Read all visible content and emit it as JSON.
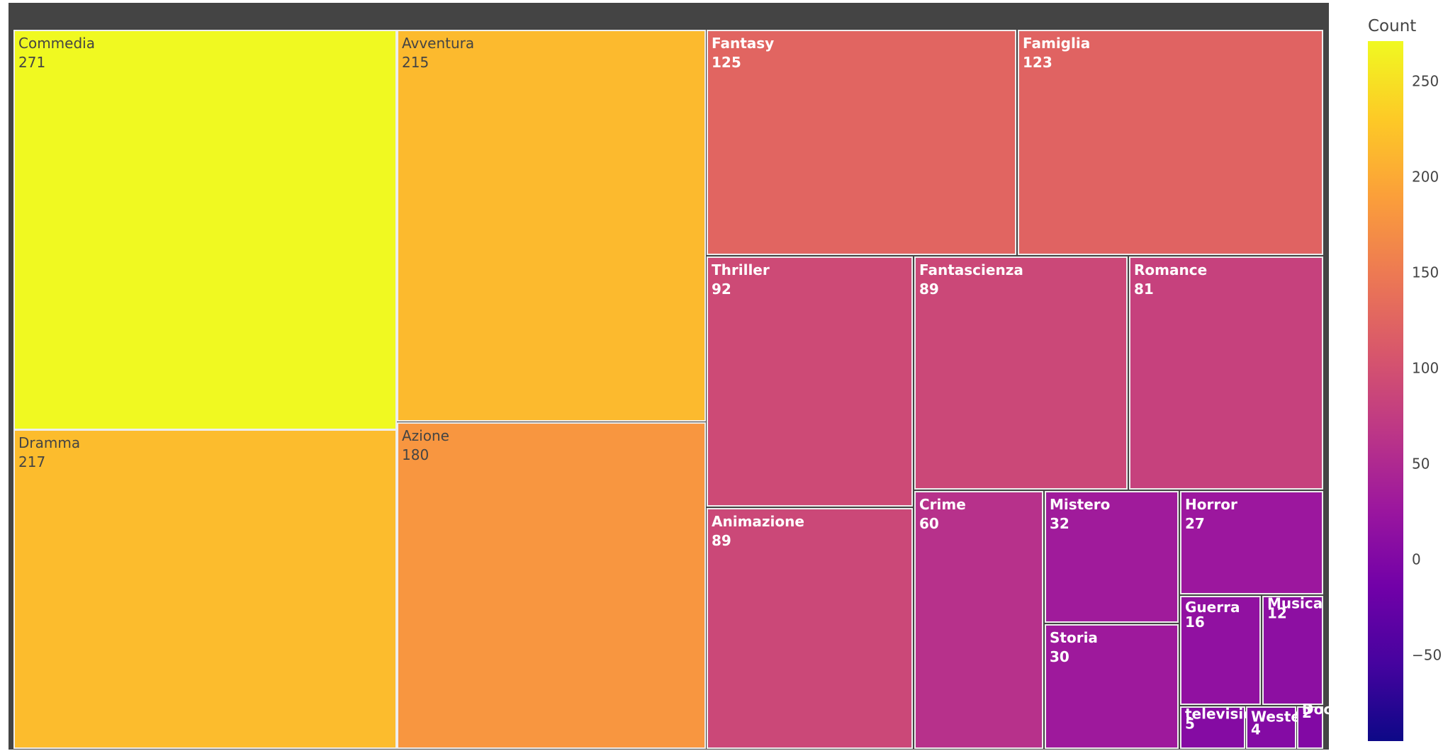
{
  "chart_data": {
    "type": "treemap",
    "value_field": "Count",
    "colorscale": [
      "#0d0887",
      "#46039f",
      "#7201a8",
      "#9c179e",
      "#bd3786",
      "#d8576b",
      "#ed7953",
      "#fb9f3a",
      "#fdca26",
      "#f0f921"
    ],
    "color_range": [
      -95,
      271
    ],
    "nodes": [
      {
        "label": "Commedia",
        "value": 271
      },
      {
        "label": "Dramma",
        "value": 217
      },
      {
        "label": "Avventura",
        "value": 215
      },
      {
        "label": "Azione",
        "value": 180
      },
      {
        "label": "Fantasy",
        "value": 125
      },
      {
        "label": "Famiglia",
        "value": 123
      },
      {
        "label": "Thriller",
        "value": 92
      },
      {
        "label": "Animazione",
        "value": 89
      },
      {
        "label": "Fantascienza",
        "value": 89
      },
      {
        "label": "Romance",
        "value": 81
      },
      {
        "label": "Crime",
        "value": 60
      },
      {
        "label": "Mistero",
        "value": 32
      },
      {
        "label": "Storia",
        "value": 30
      },
      {
        "label": "Horror",
        "value": 27
      },
      {
        "label": "Guerra",
        "value": 16
      },
      {
        "label": "Musica",
        "value": 12
      },
      {
        "label": "televisione film",
        "value": 5
      },
      {
        "label": "Western",
        "value": 4
      },
      {
        "label": "Documentario",
        "value": 2
      }
    ],
    "colorbar": {
      "title": "Count",
      "ticks": [
        "−50",
        "0",
        "50",
        "100",
        "150",
        "200",
        "250"
      ]
    }
  }
}
